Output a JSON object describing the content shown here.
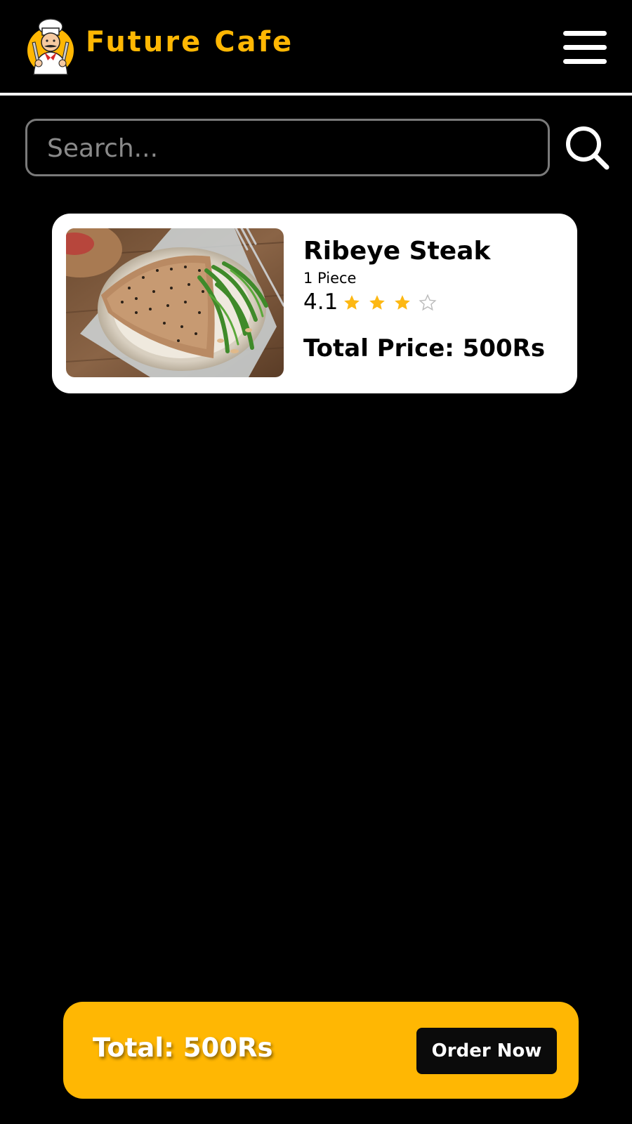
{
  "header": {
    "brand": "Future Cafe",
    "logo_icon": "chef-logo-icon",
    "menu_icon": "hamburger-menu-icon"
  },
  "search": {
    "placeholder": "Search...",
    "value": "",
    "icon": "search-icon"
  },
  "cart": {
    "items": [
      {
        "name": "Ribeye Steak",
        "quantity": "1 Piece",
        "rating": "4.1",
        "stars_filled": 3,
        "stars_total": 4,
        "total_price": "Total Price: 500Rs",
        "image_icon": "steak-plate-image"
      }
    ]
  },
  "footer": {
    "total": "Total: 500Rs",
    "order_button": "Order Now"
  },
  "colors": {
    "background": "#000000",
    "accent": "#FFB703",
    "card": "#FFFFFF",
    "star": "#FDB813",
    "button": "#0B0B0B"
  }
}
